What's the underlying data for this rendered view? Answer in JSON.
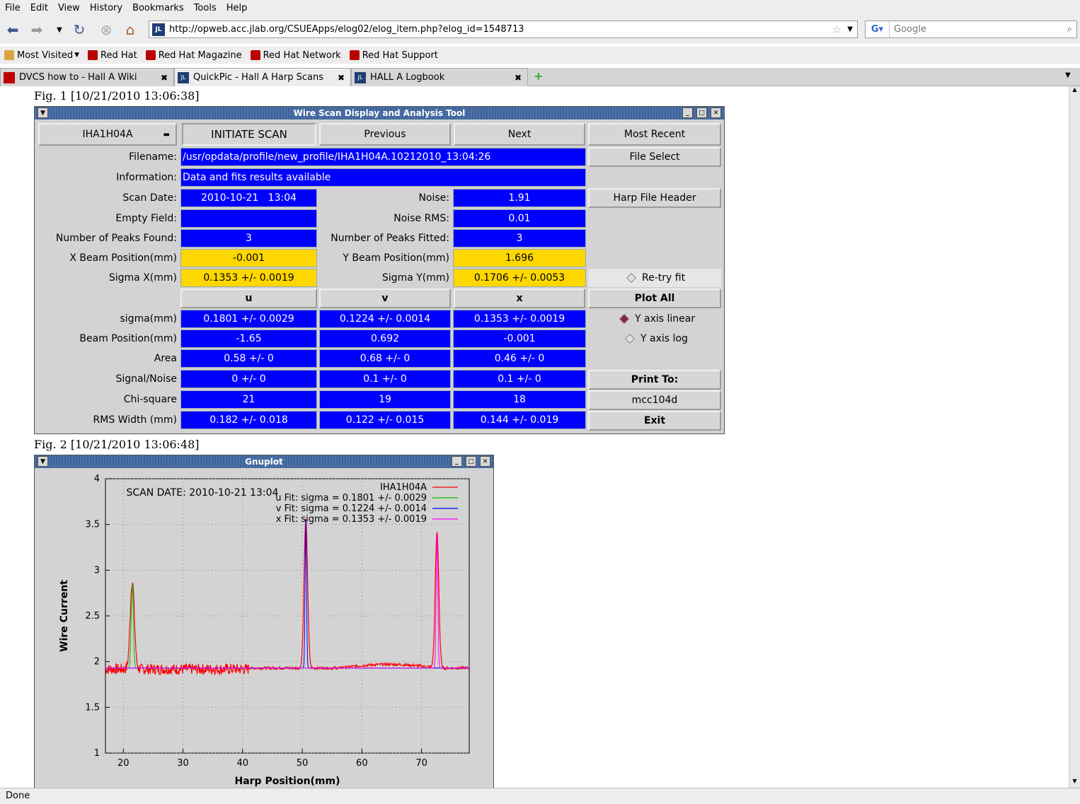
{
  "menu": [
    "File",
    "Edit",
    "View",
    "History",
    "Bookmarks",
    "Tools",
    "Help"
  ],
  "url": "http://opweb.acc.jlab.org/CSUEApps/elog02/elog_item.php?elog_id=1548713",
  "search_placeholder": "Google",
  "bookmarks": [
    "Most Visited",
    "Red Hat",
    "Red Hat Magazine",
    "Red Hat Network",
    "Red Hat Support"
  ],
  "tabs": [
    "DVCS how to - Hall A Wiki",
    "QuickPic - Hall A Harp Scans",
    "HALL A Logbook"
  ],
  "fig1": "Fig. 1 [10/21/2010 13:06:38]",
  "fig2": "Fig. 2 [10/21/2010 13:06:48]",
  "status": "Done",
  "tool": {
    "title": "Wire Scan Display and Analysis Tool",
    "device": "IHA1H04A",
    "initiate": "INITIATE SCAN",
    "previous": "Previous",
    "next": "Next",
    "most_recent": "Most Recent",
    "filename_label": "Filename:",
    "filename": "/usr/opdata/profile/new_profile/IHA1H04A.10212010_13:04:26",
    "file_select": "File Select",
    "info_label": "Information:",
    "info": "Data and fits results available",
    "scan_date_label": "Scan Date:",
    "scan_date": "2010-10-21   13:04",
    "noise_label": "Noise:",
    "noise": "1.91",
    "harp_header": "Harp File Header",
    "empty_label": "Empty Field:",
    "noise_rms_label": "Noise RMS:",
    "noise_rms": "0.01",
    "peaks_found_label": "Number of Peaks Found:",
    "peaks_found": "3",
    "peaks_fitted_label": "Number of Peaks Fitted:",
    "peaks_fitted": "3",
    "xbeam_label": "X Beam Position(mm)",
    "xbeam": "-0.001",
    "ybeam_label": "Y Beam Position(mm)",
    "ybeam": "1.696",
    "sigx_label": "Sigma X(mm)",
    "sigx": "0.1353 +/- 0.0019",
    "sigy_label": "Sigma Y(mm)",
    "sigy": "0.1706 +/- 0.0053",
    "retry": "Re-try fit",
    "col_u": "u",
    "col_v": "v",
    "col_x": "x",
    "plot_all": "Plot All",
    "ylinear": "Y axis linear",
    "ylog": "Y axis log",
    "print_to": "Print To:",
    "printer": "mcc104d",
    "exit": "Exit",
    "rows": [
      {
        "label": "sigma(mm)",
        "u": "0.1801 +/- 0.0029",
        "v": "0.1224 +/- 0.0014",
        "x": "0.1353 +/- 0.0019"
      },
      {
        "label": "Beam Position(mm)",
        "u": "-1.65",
        "v": "0.692",
        "x": "-0.001"
      },
      {
        "label": "Area",
        "u": "0.58 +/- 0",
        "v": "0.68 +/- 0",
        "x": "0.46 +/- 0"
      },
      {
        "label": "Signal/Noise",
        "u": "0 +/- 0",
        "v": "0.1 +/- 0",
        "x": "0.1 +/- 0"
      },
      {
        "label": "Chi-square",
        "u": "21",
        "v": "19",
        "x": "18"
      },
      {
        "label": "RMS Width (mm)",
        "u": "0.182 +/- 0.018",
        "v": "0.122 +/- 0.015",
        "x": "0.144 +/- 0.019"
      }
    ]
  },
  "gnuplot_title": "Gnuplot",
  "chart_data": {
    "type": "line",
    "xlabel": "Harp Position(mm)",
    "ylabel": "Wire Current",
    "xlim": [
      17,
      78
    ],
    "ylim": [
      1,
      4
    ],
    "xticks": [
      20,
      30,
      40,
      50,
      60,
      70
    ],
    "yticks": [
      1,
      1.5,
      2,
      2.5,
      3,
      3.5,
      4
    ],
    "annotation": "SCAN DATE: 2010-10-21   13:04",
    "grid": true,
    "legend_position": "top-right",
    "series": [
      {
        "name": "IHA1H04A",
        "color": "#ff0000",
        "baseline": 1.93,
        "peaks": [
          [
            21.5,
            2.9,
            0.35
          ],
          [
            50.6,
            3.55,
            0.3
          ],
          [
            72.6,
            3.42,
            0.3
          ]
        ]
      },
      {
        "name": "u  Fit: sigma = 0.1801 +/- 0.0029",
        "color": "#00c000",
        "baseline": 1.93,
        "peaks": [
          [
            21.5,
            2.85,
            0.18
          ]
        ]
      },
      {
        "name": "v  Fit: sigma = 0.1224 +/- 0.0014",
        "color": "#0000ff",
        "baseline": 1.93,
        "peaks": [
          [
            50.6,
            3.55,
            0.12
          ]
        ]
      },
      {
        "name": "x  Fit: sigma = 0.1353 +/- 0.0019",
        "color": "#ff00ff",
        "baseline": 1.93,
        "peaks": [
          [
            72.6,
            3.42,
            0.14
          ]
        ]
      }
    ]
  }
}
